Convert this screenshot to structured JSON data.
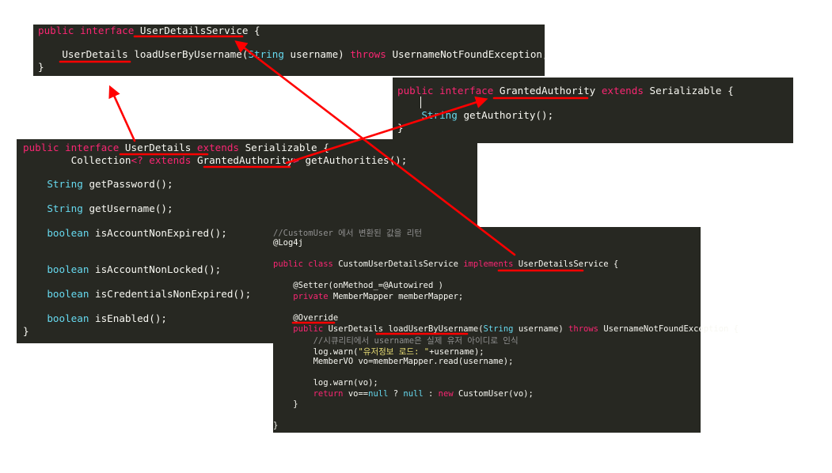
{
  "colors": {
    "panel_bg": "#272822",
    "keyword": "#f92672",
    "type": "#66d9ef",
    "string": "#e6db74",
    "comment": "#8f8f8f",
    "text": "#f8f8f2",
    "annotation_arrow": "#ff0000"
  },
  "user_details_service": {
    "line1": {
      "kw": "public interface",
      "name": "UserDetailsService",
      "brace": "{"
    },
    "line2": {
      "ret": "UserDetails",
      "method": "loadUserByUsername(",
      "param_type": "String",
      "param": "username)",
      "throws_kw": "throws",
      "exception": "UsernameNotFoundException;"
    },
    "line3": "}"
  },
  "granted_authority": {
    "line1": {
      "kw": "public interface",
      "name": "GrantedAuthority",
      "extends_kw": "extends",
      "parent": "Serializable",
      "brace": "{"
    },
    "line2": {
      "type": "String",
      "method": "getAuthority();"
    },
    "line3": "}"
  },
  "user_details": {
    "line1": {
      "kw": "public interface",
      "name": "UserDetails",
      "extends_kw": "extends",
      "parent": "Serializable",
      "brace": "{"
    },
    "line2": {
      "collection": "Collection",
      "lt": "<?",
      "extends_kw": "extends",
      "authority": "GrantedAuthority",
      "gt": ">",
      "method": "getAuthorities();"
    },
    "methods": [
      {
        "type": "String",
        "name": "getPassword();"
      },
      {
        "type": "String",
        "name": "getUsername();"
      },
      {
        "type": "boolean",
        "name": "isAccountNonExpired();"
      },
      {
        "type": "boolean",
        "name": "isAccountNonLocked();"
      },
      {
        "type": "boolean",
        "name": "isCredentialsNonExpired();"
      },
      {
        "type": "boolean",
        "name": "isEnabled();"
      }
    ],
    "close": "}"
  },
  "custom_service": {
    "comment": "//CustomUser 에서 변환된 값을 리턴",
    "annotation_log": "@Log4j",
    "class_line": {
      "kw": "public class",
      "name": "CustomUserDetailsService",
      "impl_kw": "implements",
      "iface": "UserDetailsService",
      "brace": "{"
    },
    "setter": "@Setter(onMethod_=@Autowired )",
    "field": {
      "kw": "private",
      "rest": "MemberMapper memberMapper;"
    },
    "override": "@Override",
    "method_line": {
      "kw": "public",
      "ret": "UserDetails",
      "name": "loadUserByUsername(",
      "param_type": "String",
      "param": "username)",
      "throws_kw": "throws",
      "exception": "UsernameNotFoundException {"
    },
    "inner_comment": "//시큐리티에서 username은 실제 유저 아이디로 인식",
    "warn1": {
      "pre": "log.warn(",
      "str": "\"유저정보 로드: \"",
      "post": "+username);"
    },
    "read_line": "MemberVO vo=memberMapper.read(username);",
    "warn2": "log.warn(vo);",
    "return_line": {
      "kw": "return",
      "cond": "vo==",
      "null1": "null",
      "q": " ? ",
      "null2": "null",
      "colon": " : ",
      "new_kw": "new",
      "rest": "CustomUser(vo);"
    },
    "inner_close": "}",
    "close": "}"
  }
}
